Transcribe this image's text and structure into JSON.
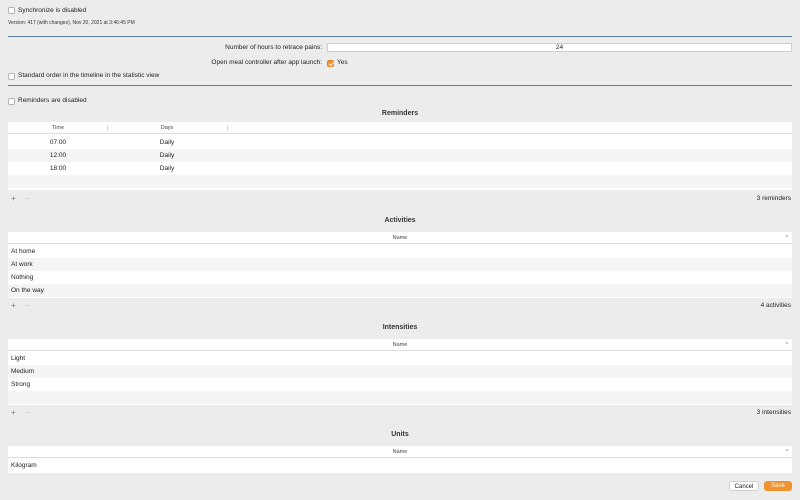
{
  "sync": {
    "label": "Synchronize is disabled",
    "checked": false
  },
  "version": "Version: 417 (with changes), Nov 20, 2021 at 3:46:45 PM",
  "settings": {
    "hours_label": "Number of hours to retrace pains:",
    "hours_value": "24",
    "meal_label": "Open meal controller after app launch:",
    "meal_option": "Yes",
    "standard_order_label": "Standard order in the timeline in the statistic view"
  },
  "reminders_toggle": {
    "label": "Reminders are disabled"
  },
  "reminders": {
    "title": "Reminders",
    "columns": [
      "Time",
      "Days"
    ],
    "rows": [
      {
        "time": "07:00",
        "days": "Daily"
      },
      {
        "time": "12:00",
        "days": "Daily"
      },
      {
        "time": "18:00",
        "days": "Daily"
      }
    ],
    "count": "3 reminders"
  },
  "activities": {
    "title": "Activities",
    "column": "Name",
    "rows": [
      "At home",
      "At work",
      "Nothing",
      "On the way"
    ],
    "count": "4 activities"
  },
  "intensities": {
    "title": "Intensities",
    "column": "Name",
    "rows": [
      "Light",
      "Medium",
      "Strong"
    ],
    "count": "3 intensities"
  },
  "units": {
    "title": "Units",
    "column": "Name",
    "rows": [
      "Kilogram"
    ]
  },
  "footer": {
    "add": "+",
    "remove": "−",
    "sort": "^"
  },
  "actions": {
    "cancel": "Cancel",
    "save": "Save"
  },
  "colors": {
    "accent": "#f0922e",
    "divider": "#5b7f9f"
  }
}
